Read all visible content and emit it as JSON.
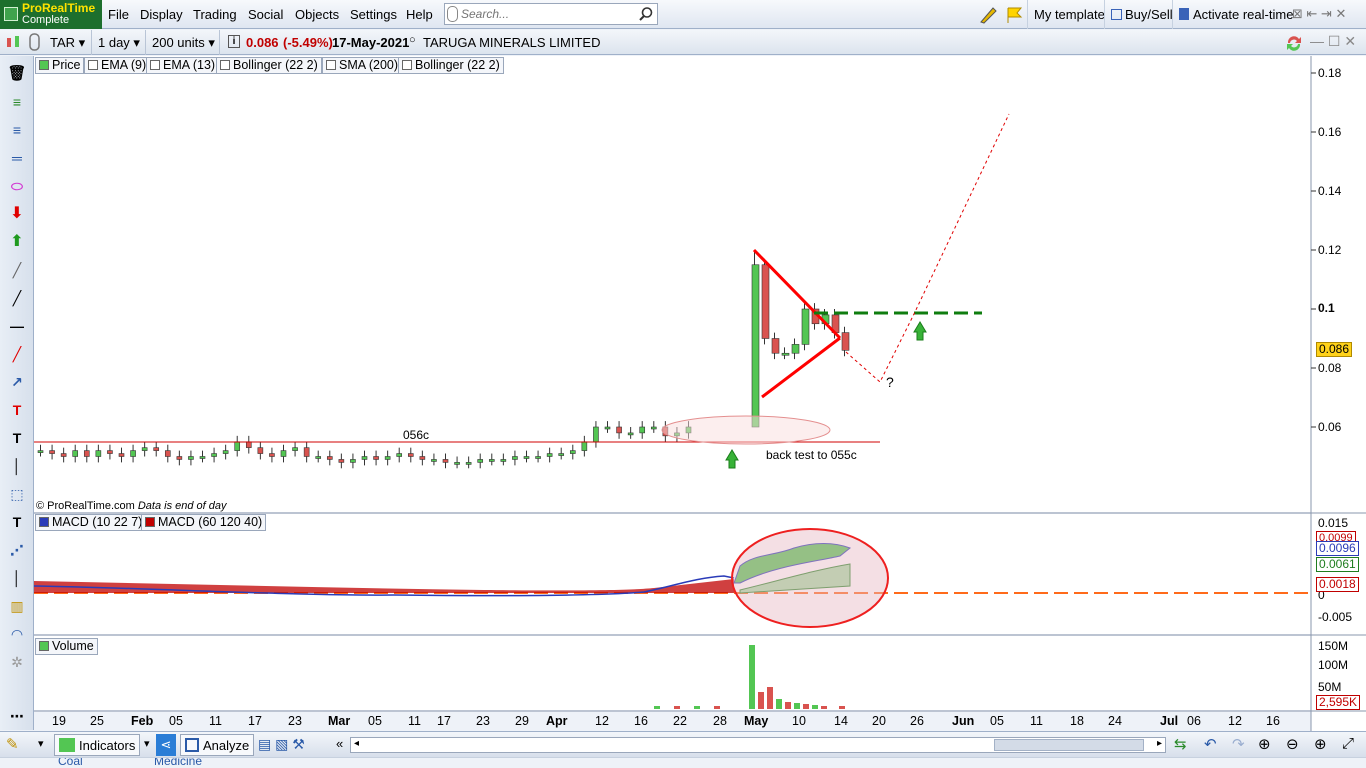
{
  "app": {
    "brand": "ProRealTime",
    "edition": "Complete"
  },
  "menu": [
    "File",
    "Display",
    "Trading",
    "Social",
    "Objects",
    "Settings",
    "Help"
  ],
  "search": {
    "placeholder": "Search..."
  },
  "topright": {
    "template": "My template",
    "buysell": "Buy/Sell",
    "realtime": "Activate real-time"
  },
  "ctrl": {
    "ticker": "TAR",
    "timeframe": "1 day",
    "units": "200 units",
    "last": "0.086",
    "change": "(-5.49%)",
    "date": "17-May-2021",
    "name": "TARUGA MINERALS LIMITED"
  },
  "indicators": [
    "Price",
    "EMA (9)",
    "EMA (13)",
    "Bollinger (22 2)",
    "SMA (200)",
    "Bollinger (22 2)"
  ],
  "macd_legend": [
    "MACD (10 22 7)",
    "MACD (60 120 40)"
  ],
  "volume_legend": "Volume",
  "annotations": {
    "level": "056c",
    "backtest": "back test to 055c",
    "question": "?",
    "credit": "© ProRealTime.com",
    "credit_note": "Data is end of day"
  },
  "yaxis_price": [
    "0.18",
    "0.16",
    "0.14",
    "0.12",
    "0.1",
    "0.08",
    "0.06"
  ],
  "yaxis_macd": [
    "0.015",
    "0",
    "-0.005"
  ],
  "yaxis_volume": [
    "150M",
    "100M",
    "50M"
  ],
  "tags": {
    "price": "0.086",
    "macd1": "0.0096",
    "macd2": "0.0061",
    "macd3": "0.0018",
    "macd_top": "0.0099",
    "volume": "2,595K"
  },
  "xaxis": [
    "19",
    "25",
    "Feb",
    "05",
    "11",
    "17",
    "23",
    "Mar",
    "05",
    "11",
    "17",
    "23",
    "29",
    "Apr",
    "12",
    "16",
    "22",
    "28",
    "May",
    "10",
    "14",
    "20",
    "26",
    "Jun",
    "05",
    "11",
    "18",
    "24",
    "Jul",
    "06",
    "12",
    "16"
  ],
  "bottom": {
    "indicators": "Indicators",
    "analyze": "Analyze"
  },
  "strip": [
    "Coal",
    "Medicine"
  ],
  "colors": {
    "up": "#53c653",
    "down": "#d9534f",
    "level_line": "#d00000",
    "triangle": "#ff0000",
    "dashed_green": "#0f7d0f",
    "macd_zero": "#ff6a1a",
    "menu_green": "#1d6f2d"
  },
  "chart_data": [
    {
      "type": "candlestick",
      "title": "",
      "series": [
        {
          "name": "Price",
          "values": [
            0.052,
            0.051,
            0.05,
            0.052,
            0.05,
            0.052,
            0.051,
            0.05,
            0.052,
            0.053,
            0.052,
            0.05,
            0.049,
            0.05,
            0.05,
            0.051,
            0.052,
            0.055,
            0.053,
            0.051,
            0.05,
            0.052,
            0.053,
            0.05,
            0.05,
            0.049,
            0.048,
            0.049,
            0.05,
            0.049,
            0.05,
            0.051,
            0.05,
            0.049,
            0.049,
            0.048,
            0.048,
            0.048,
            0.049,
            0.049,
            0.049,
            0.05,
            0.05,
            0.05,
            0.051,
            0.051,
            0.052,
            0.055,
            0.06,
            0.06,
            0.058,
            0.058,
            0.06,
            0.06,
            0.057,
            0.058,
            0.06,
            0.115,
            0.09,
            0.085,
            0.085,
            0.088,
            0.1,
            0.095,
            0.098,
            0.092,
            0.086
          ]
        }
      ],
      "ylim": [
        0.04,
        0.185
      ],
      "grid": false
    },
    {
      "type": "line",
      "title": "",
      "series": [
        {
          "name": "MACD (10 22 7)",
          "values": []
        },
        {
          "name": "MACD (60 120 40)",
          "values": []
        }
      ],
      "ylim": [
        -0.007,
        0.016
      ]
    },
    {
      "type": "bar",
      "title": "",
      "series": [
        {
          "name": "Volume",
          "values": []
        }
      ],
      "ylim": [
        0,
        160
      ]
    }
  ]
}
